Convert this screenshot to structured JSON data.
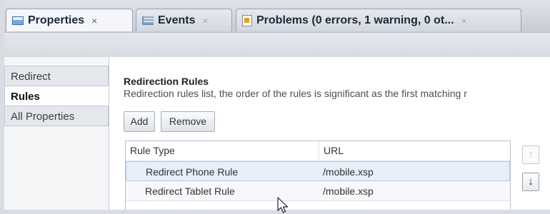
{
  "tabs": [
    {
      "label": "Properties",
      "close": "×",
      "icon": "properties-icon",
      "active": true
    },
    {
      "label": "Events",
      "close": "×",
      "icon": "events-icon",
      "active": false
    },
    {
      "label": "Problems (0 errors, 1 warning, 0 ot...",
      "close": "×",
      "icon": "problems-icon",
      "active": false
    }
  ],
  "sidebar": {
    "items": [
      {
        "label": "Redirect",
        "active": false
      },
      {
        "label": "Rules",
        "active": true
      },
      {
        "label": "All Properties",
        "active": false
      }
    ]
  },
  "section": {
    "title": "Redirection Rules",
    "description": "Redirection rules list, the order of the rules is significant as the first matching r"
  },
  "buttons": {
    "add": "Add",
    "remove": "Remove"
  },
  "table": {
    "columns": [
      "Rule Type",
      "URL"
    ],
    "rows": [
      {
        "rule_type": "Redirect Phone Rule",
        "url": "/mobile.xsp",
        "selected": true
      },
      {
        "rule_type": "Redirect Tablet Rule",
        "url": "/mobile.xsp",
        "selected": false
      }
    ]
  },
  "move_controls": {
    "up": "↑",
    "down": "↓",
    "up_enabled": false,
    "down_enabled": true
  },
  "colors": {
    "selected_row": "#e6eefa",
    "selection_border": "#b5c8e6"
  }
}
